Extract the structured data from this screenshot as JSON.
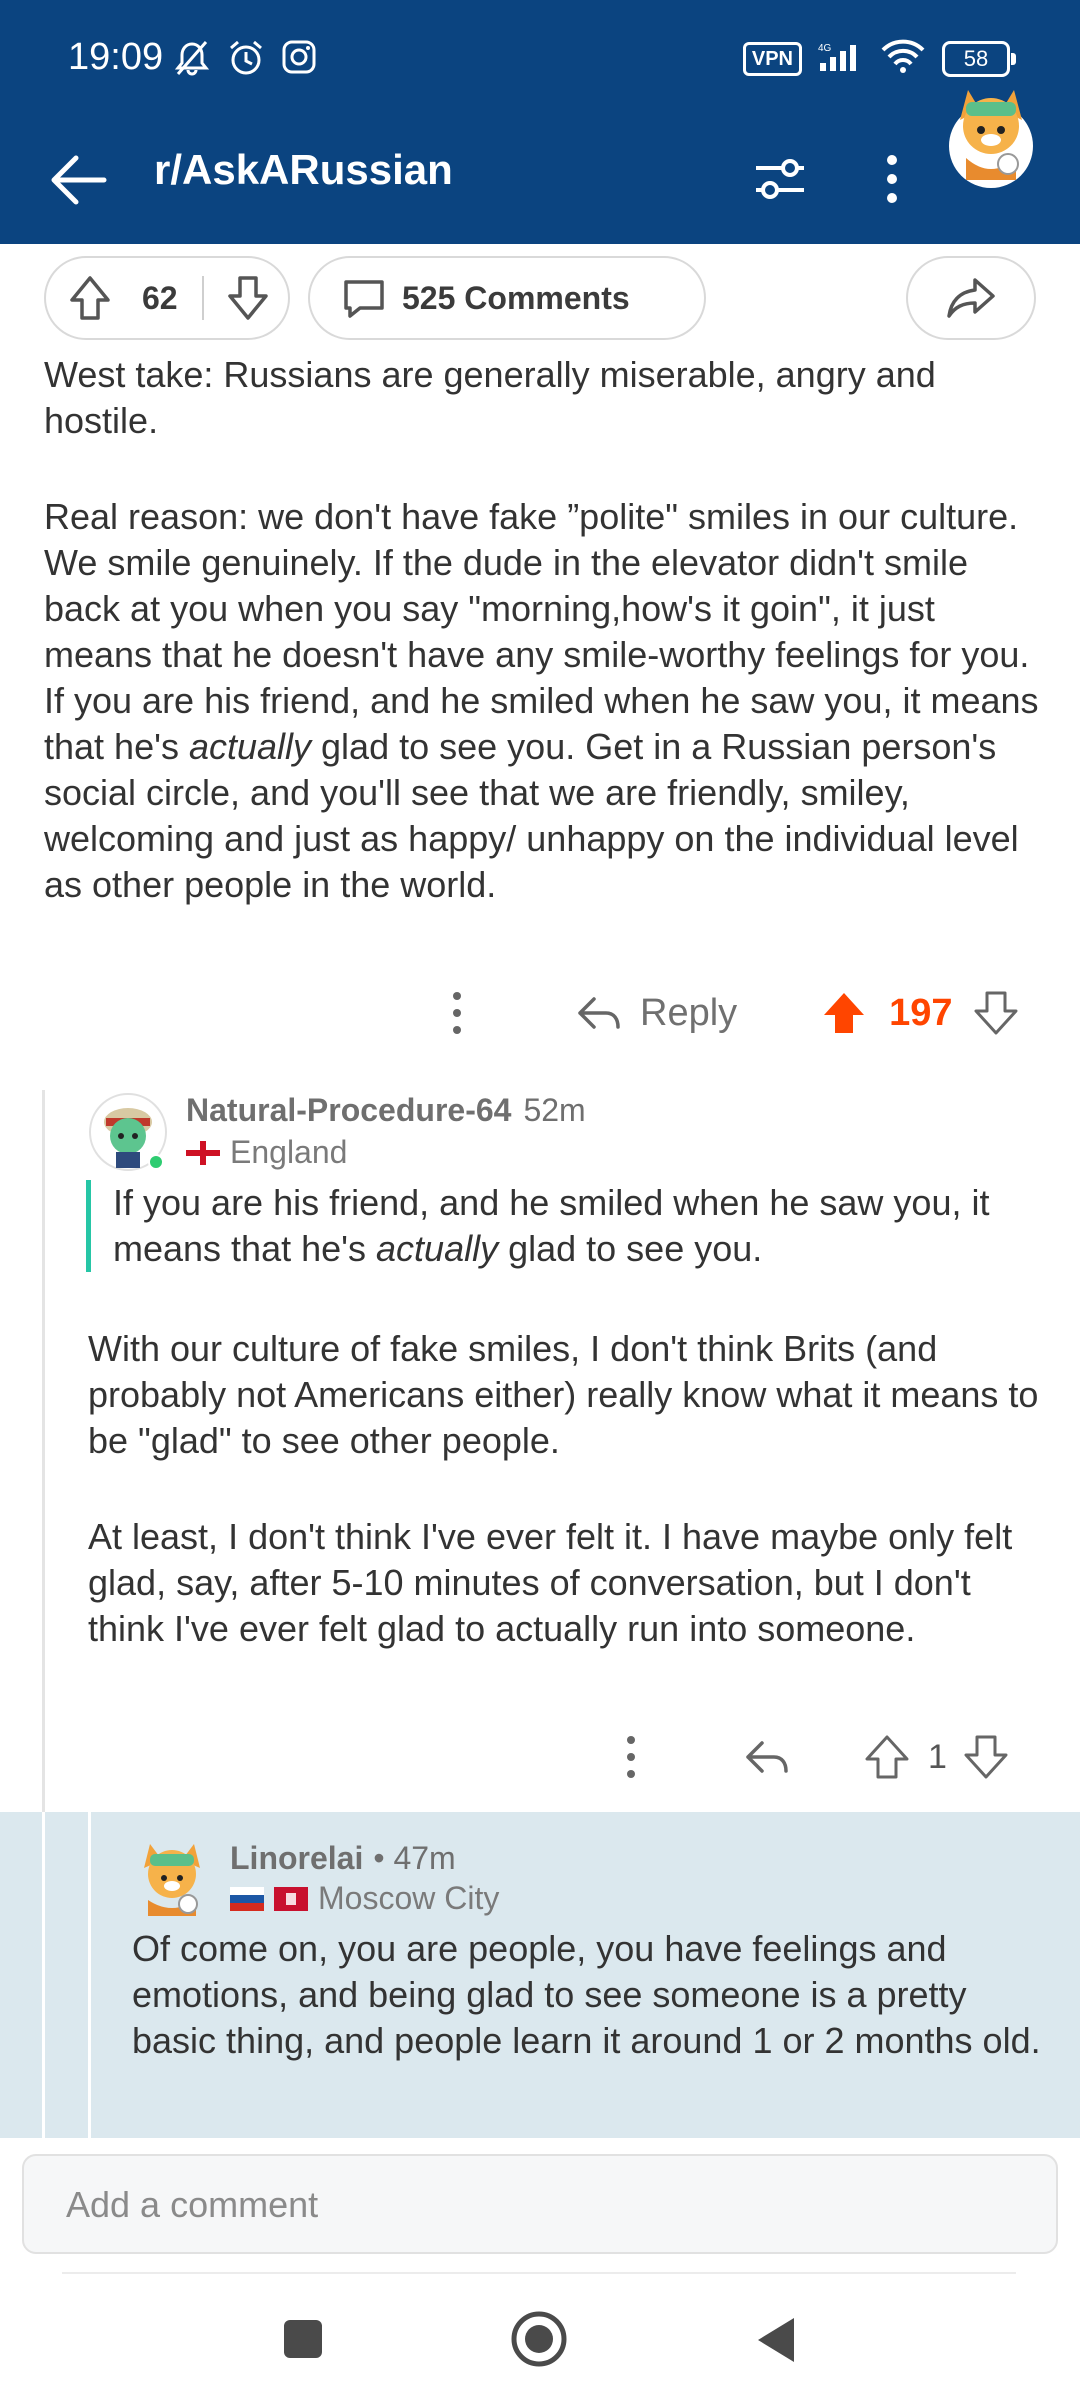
{
  "status_bar": {
    "time": "19:09",
    "left_icons": [
      "bell-off-icon",
      "alarm-icon",
      "instagram-icon"
    ],
    "vpn_label": "VPN",
    "battery": "58"
  },
  "app_bar": {
    "title": "r/AskARussian",
    "icons": [
      "back-arrow-icon",
      "filter-icon",
      "more-vertical-icon",
      "user-avatar"
    ]
  },
  "post_actions": {
    "vote_count": "62",
    "comments_label": "525 Comments"
  },
  "main_comment": {
    "paragraph1": "West take: Russians are generally miserable, angry and hostile.",
    "p2_before": "Real reason: we don't have fake ”polite\" smiles in our culture. We smile genuinely. If the dude in the elevator didn't smile back at you when you say \"morning,how's it goin\", it just means that he doesn't have any smile-worthy feelings for you. If you are his friend, and he smiled when he saw you, it means that he's ",
    "p2_italic": "actually",
    "p2_after": " glad to see you. Get in a Russian person's social circle, and you'll see that we are friendly, smiley, welcoming and just as happy/ unhappy on the individual level as other people in the world.",
    "reply_label": "Reply",
    "score": "197"
  },
  "reply1": {
    "username": "Natural-Procedure-64",
    "time": "52m",
    "flair": "England",
    "quote_before": "If you are his friend, and he smiled when he saw you, it means that he's ",
    "quote_italic": "actually",
    "quote_after": " glad to see you.",
    "paragraph1": "With our culture of fake smiles, I don't think Brits (and probably not Americans either) really know what it means to be \"glad\" to see other people.",
    "paragraph2": "At least, I don't think I've ever felt it. I have maybe only felt glad, say, after 5-10 minutes of conversation, but I don't think I've ever felt glad to actually run into someone.",
    "score": "1"
  },
  "reply2": {
    "username": "Linorelai",
    "time": "• 47m",
    "flair": "Moscow City",
    "body": "Of come on, you are people, you have feelings and emotions, and being glad to see someone is a pretty basic thing, and people learn it around 1 or 2 months old.",
    "highlight_color": "#dbe8ee"
  },
  "composer": {
    "placeholder": "Add a comment"
  },
  "colors": {
    "app_bar": "#0b4480",
    "upvote_active": "#ff4500",
    "quote_bar": "#26c6a6"
  }
}
